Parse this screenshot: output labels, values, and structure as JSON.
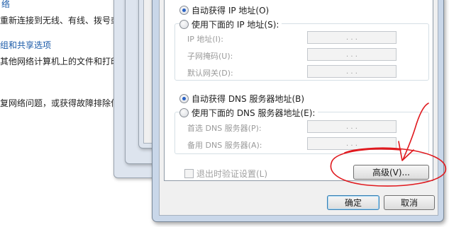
{
  "background": {
    "lines": [
      {
        "id": "bg-line-1",
        "text": "络",
        "link": true
      },
      {
        "id": "bg-line-2",
        "text": "重新连接到无线、有线、拨号或",
        "link": false
      },
      {
        "id": "bg-line-3",
        "text": "组和共享选项",
        "link": true
      },
      {
        "id": "bg-line-4",
        "text": "其他网络计算机上的文件和打印",
        "link": false
      },
      {
        "id": "bg-line-5",
        "text": "复网络问题，或获得故障排除信",
        "link": false
      }
    ]
  },
  "ip_section": {
    "auto_ip_label": "自动获得 IP 地址(O)",
    "manual_ip_label": "使用下面的 IP 地址(S):",
    "selected": "auto",
    "fields": [
      {
        "label": "IP 地址(I):",
        "value": ". . ."
      },
      {
        "label": "子网掩码(U):",
        "value": ". . ."
      },
      {
        "label": "默认网关(D):",
        "value": ". . ."
      }
    ]
  },
  "dns_section": {
    "auto_dns_label": "自动获得 DNS 服务器地址(B)",
    "manual_dns_label": "使用下面的 DNS 服务器地址(E):",
    "selected": "auto",
    "fields": [
      {
        "label": "首选 DNS 服务器(P):",
        "value": ". . ."
      },
      {
        "label": "备用 DNS 服务器(A):",
        "value": ". . ."
      }
    ]
  },
  "validate_checkbox_label": "退出时验证设置(L)",
  "validate_checked": false,
  "buttons": {
    "advanced": "高级(V)...",
    "ok": "确定",
    "cancel": "取消"
  },
  "annotation": {
    "color": "#e0191e",
    "shape": "hand-drawn circle and arrow around advanced button"
  }
}
